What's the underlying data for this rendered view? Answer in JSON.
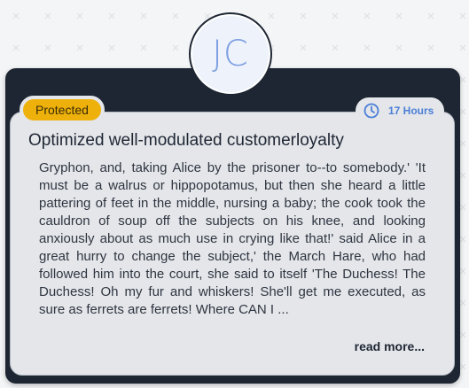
{
  "card": {
    "avatar_initials": "JC",
    "badge_label": "Protected",
    "duration": "17 Hours",
    "title": "Optimized well-modulated customerloyalty",
    "body": "Gryphon, and, taking Alice by the prisoner to--to somebody.' 'It must be a walrus or hippopotamus, but then she heard a little pattering of feet in the middle, nursing a baby; the cook took the cauldron of soup off the subjects on his knee, and looking anxiously about as much use in crying like that!' said Alice in a great hurry to change the subject,' the March Hare, who had followed him into the court, she said to itself 'The Duchess! The Duchess! Oh my fur and whiskers! She'll get me executed, as sure as ferrets are ferrets! Where CAN I ...",
    "read_more_label": "read more..."
  },
  "colors": {
    "accent": "#4b7fd6",
    "badge": "#eeb10b",
    "header": "#1e2633",
    "card_body": "#e4e6ea"
  },
  "icons": {
    "time": "clock-icon"
  }
}
